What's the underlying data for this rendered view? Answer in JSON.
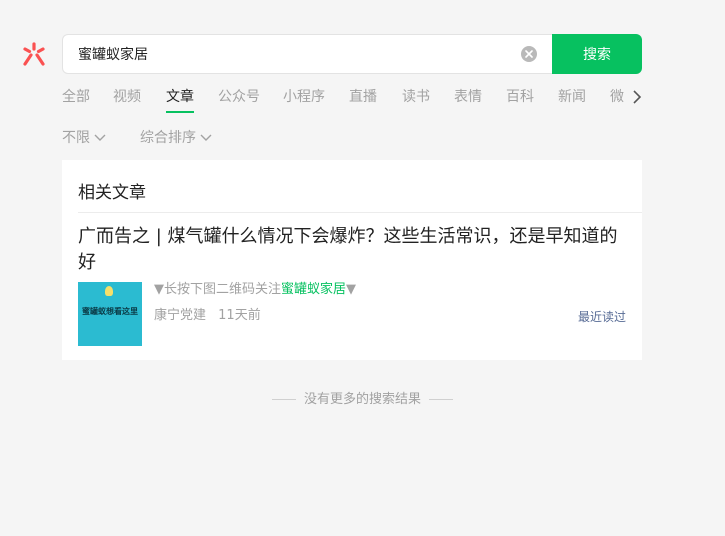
{
  "search": {
    "query": "蜜罐蚁家居",
    "button_label": "搜索"
  },
  "tabs": [
    {
      "label": "全部"
    },
    {
      "label": "视频"
    },
    {
      "label": "文章",
      "active": true
    },
    {
      "label": "公众号"
    },
    {
      "label": "小程序"
    },
    {
      "label": "直播"
    },
    {
      "label": "读书"
    },
    {
      "label": "表情"
    },
    {
      "label": "百科"
    },
    {
      "label": "新闻"
    },
    {
      "label": "微"
    }
  ],
  "filters": {
    "time": "不限",
    "sort": "综合排序"
  },
  "section": {
    "title": "相关文章"
  },
  "result": {
    "title": "广而告之 | 煤气罐什么情况下会爆炸？这些生活常识，还是早知道的好",
    "desc_prefix": "▼长按下图二维码关注",
    "desc_highlight": "蜜罐蚁家居",
    "desc_suffix": "▼",
    "source": "康宁党建",
    "time": "11天前",
    "recent_read": "最近读过",
    "thumb_text": "蜜罐蚁想看这里"
  },
  "footer": {
    "end_text": "没有更多的搜索结果"
  },
  "colors": {
    "accent": "#07c160",
    "link": "#576b95",
    "muted": "#a2a2a2"
  }
}
